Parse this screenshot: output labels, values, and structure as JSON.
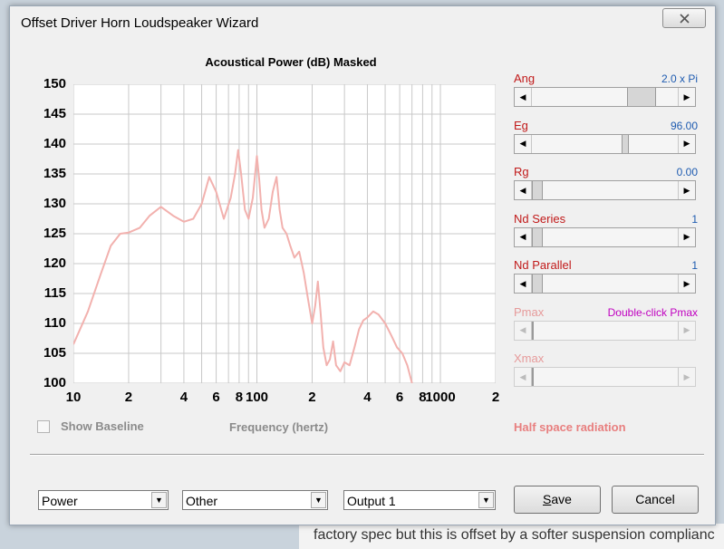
{
  "window": {
    "title": "Offset Driver Horn Loudspeaker Wizard"
  },
  "background": {
    "text": "factory spec but this is offset by a softer suspension complianc"
  },
  "chart": {
    "title": "Acoustical Power (dB)   Masked",
    "show_baseline_label": "Show Baseline",
    "xlabel": "Frequency (hertz)",
    "radiation_label": "Half space radiation"
  },
  "params": [
    {
      "label": "Ang",
      "value": "2.0 x Pi",
      "thumb": 0.67,
      "enabled": true,
      "value_color": "#1e5bb0"
    },
    {
      "label": "Eg",
      "value": "96.00",
      "thumb": 0.63,
      "enabled": true,
      "value_color": "#1e5bb0"
    },
    {
      "label": "Rg",
      "value": "0.00",
      "thumb": 0.0,
      "enabled": true,
      "value_color": "#1e5bb0"
    },
    {
      "label": "Nd Series",
      "value": "1",
      "thumb": 0.0,
      "enabled": true,
      "value_color": "#1e5bb0"
    },
    {
      "label": "Nd Parallel",
      "value": "1",
      "thumb": 0.0,
      "enabled": true,
      "value_color": "#1e5bb0"
    },
    {
      "label": "Pmax",
      "value": "Double-click Pmax",
      "thumb": 0.0,
      "enabled": false,
      "value_color": "#c000c0"
    },
    {
      "label": "Xmax",
      "value": "",
      "thumb": 0.0,
      "enabled": false,
      "value_color": "#1e5bb0"
    }
  ],
  "controls": {
    "combo1": "Power",
    "combo2": "Other",
    "combo3": "Output 1",
    "save_label_pre": "",
    "save_label_accel": "S",
    "save_label_post": "ave",
    "cancel_label": "Cancel"
  },
  "colors": {
    "curve": "#f2b1ae",
    "grid": "#c8c8c8",
    "label_red": "#c11a1a",
    "value_blue": "#1e5bb0"
  },
  "chart_data": {
    "type": "line",
    "title": "Acoustical Power (dB)   Masked",
    "xlabel": "Frequency (hertz)",
    "ylabel": "",
    "x_scale": "log",
    "xlim": [
      10,
      2000
    ],
    "ylim": [
      100,
      150
    ],
    "yticks": [
      100,
      105,
      110,
      115,
      120,
      125,
      130,
      135,
      140,
      145,
      150
    ],
    "xtick_labels": [
      {
        "x": 10,
        "label": "10"
      },
      {
        "x": 20,
        "label": "2"
      },
      {
        "x": 40,
        "label": "4"
      },
      {
        "x": 60,
        "label": "6"
      },
      {
        "x": 80,
        "label": "8"
      },
      {
        "x": 100,
        "label": "100"
      },
      {
        "x": 200,
        "label": "2"
      },
      {
        "x": 400,
        "label": "4"
      },
      {
        "x": 600,
        "label": "6"
      },
      {
        "x": 800,
        "label": "8"
      },
      {
        "x": 1000,
        "label": "1000"
      },
      {
        "x": 2000,
        "label": "2"
      }
    ],
    "grid": true,
    "series": [
      {
        "x": [
          10,
          12,
          14,
          16,
          18,
          20,
          23,
          26,
          30,
          35,
          40,
          45,
          50,
          55,
          60,
          66,
          72,
          76,
          79,
          82,
          86,
          90,
          95,
          100,
          103,
          106,
          110,
          116,
          122,
          128,
          133,
          138,
          145,
          152,
          160,
          170,
          180,
          190,
          200,
          208,
          215,
          222,
          230,
          240,
          250,
          260,
          270,
          285,
          300,
          320,
          340,
          360,
          380,
          400,
          430,
          460,
          500,
          540,
          580,
          620,
          660,
          700
        ],
        "y": [
          106.5,
          112,
          118,
          123,
          125,
          125.2,
          126,
          128,
          129.5,
          128,
          127,
          127.5,
          130,
          134.5,
          132,
          127.5,
          131,
          135,
          139,
          135,
          129,
          127.5,
          131,
          138,
          134,
          129,
          126,
          127.5,
          132,
          134.5,
          129,
          126,
          125,
          123,
          121,
          122,
          118.5,
          114,
          110,
          113,
          117,
          112,
          106,
          103,
          104,
          107,
          103,
          102,
          103.5,
          103,
          106,
          109,
          110.5,
          111,
          112,
          111.5,
          110,
          108,
          106,
          105,
          103,
          100
        ]
      }
    ]
  }
}
